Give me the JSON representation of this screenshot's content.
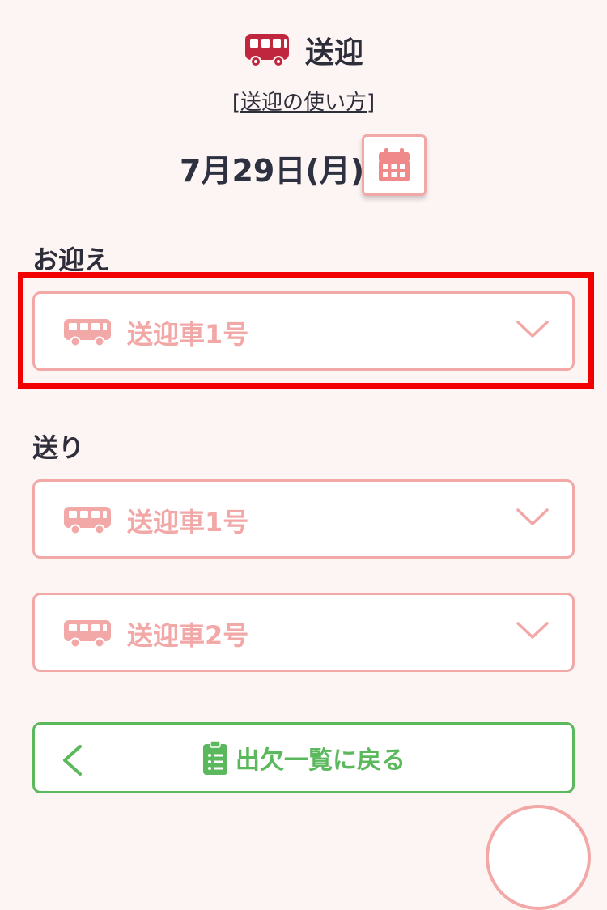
{
  "header": {
    "title": "送迎",
    "icon": "bus-icon",
    "icon_color": "#c0273f"
  },
  "howto_link": {
    "open_bracket": "[",
    "label": "送迎の使い方",
    "close_bracket": "]"
  },
  "date": {
    "label": "7月29日(月)",
    "calendar_icon": "calendar-icon"
  },
  "pickup": {
    "label": "お迎え",
    "selects": [
      {
        "value": "送迎車1号",
        "icon": "bus-icon"
      }
    ]
  },
  "dropoff": {
    "label": "送り",
    "selects": [
      {
        "value": "送迎車1号",
        "icon": "bus-icon"
      },
      {
        "value": "送迎車2号",
        "icon": "bus-icon"
      }
    ]
  },
  "back_button": {
    "label": "出欠一覧に戻る",
    "icon": "clipboard-list-icon",
    "arrow_icon": "chevron-left-icon"
  },
  "colors": {
    "background": "#fdf4f4",
    "accent_pink": "#f3a8a8",
    "accent_green": "#5cb85c",
    "highlight_red": "#f20000"
  }
}
